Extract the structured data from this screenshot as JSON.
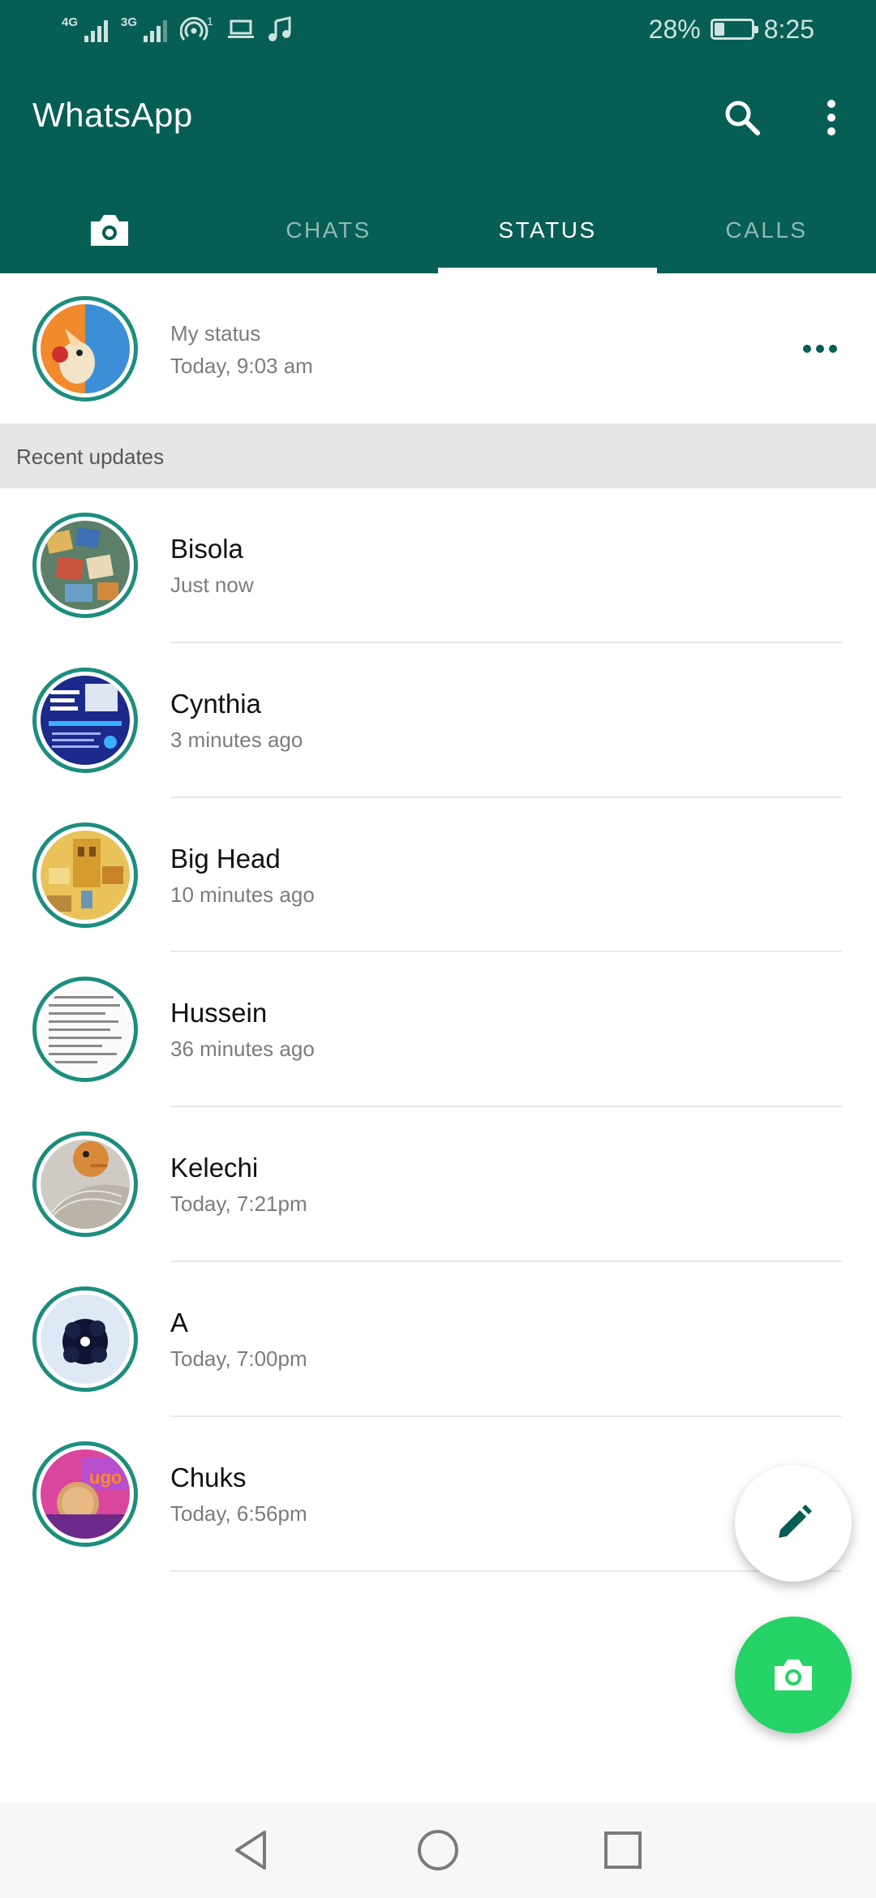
{
  "status_bar": {
    "network_1": "4G",
    "network_2": "3G",
    "hotspot_count": "1",
    "battery_percent": "28%",
    "battery_level": 0.28,
    "time": "8:25",
    "icons": [
      "signal-icon",
      "signal-icon",
      "hotspot-icon",
      "laptop-icon",
      "music-note-icon",
      "battery-icon"
    ]
  },
  "header": {
    "title": "WhatsApp",
    "search_icon": "search-icon",
    "menu_icon": "more-vert-icon"
  },
  "tabs": [
    {
      "label": "",
      "icon": "camera-icon"
    },
    {
      "label": "CHATS"
    },
    {
      "label": "STATUS",
      "active": true
    },
    {
      "label": "CALLS"
    }
  ],
  "my_status": {
    "label": "My status",
    "time": "Today, 9:03 am",
    "menu_icon": "more-horiz-icon"
  },
  "recent_updates": {
    "heading": "Recent updates",
    "items": [
      {
        "name": "Bisola",
        "time": "Just now"
      },
      {
        "name": "Cynthia",
        "time": "3 minutes ago"
      },
      {
        "name": "Big Head",
        "time": "10 minutes ago"
      },
      {
        "name": "Hussein",
        "time": "36 minutes ago"
      },
      {
        "name": "Kelechi",
        "time": "Today, 7:21pm"
      },
      {
        "name": "A",
        "time": "Today, 7:00pm"
      },
      {
        "name": "Chuks",
        "time": "Today, 6:56pm"
      }
    ]
  },
  "fabs": {
    "text_status_icon": "pencil-icon",
    "camera_status_icon": "camera-icon"
  },
  "nav_bar": {
    "icons": [
      "back-icon",
      "home-icon",
      "recents-icon"
    ]
  },
  "colors": {
    "primary": "#075e54",
    "accent": "#25d366",
    "ring": "#1d8d7e"
  }
}
